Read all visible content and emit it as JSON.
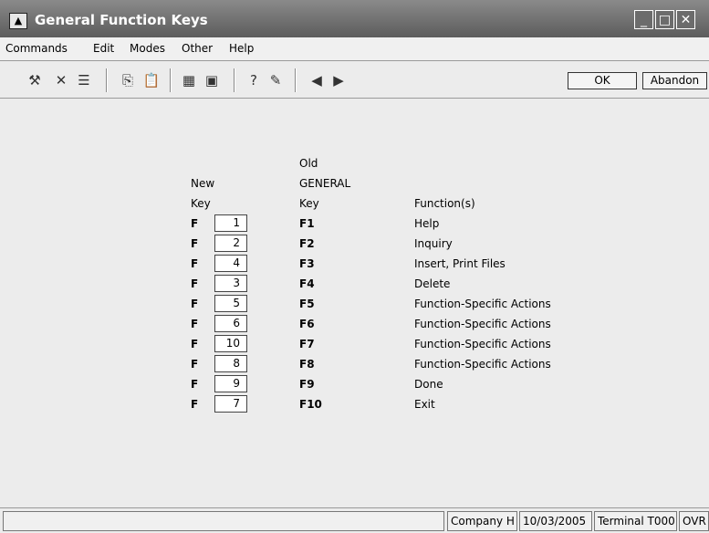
{
  "window": {
    "title": "General Function Keys",
    "icon": "app-icon",
    "controls": [
      "minimize",
      "maximize",
      "close"
    ]
  },
  "menu": [
    "Commands",
    "Edit",
    "Modes",
    "Other",
    "Help"
  ],
  "toolbar": {
    "icons": [
      "hammer-icon",
      "delete-x-icon",
      "list-icon",
      "copy-icon",
      "paste-icon",
      "calculator-icon",
      "calendar-icon",
      "help-question-icon",
      "notebook-icon",
      "previous-icon",
      "next-icon"
    ],
    "ok_label": "OK",
    "abandon_label": "Abandon"
  },
  "header": {
    "new_col": [
      "New",
      "Key"
    ],
    "old_col": [
      "Old",
      "GENERAL",
      "Key"
    ],
    "function_col": "Function(s)"
  },
  "rows": [
    {
      "prefix": "F",
      "new": "1",
      "old": "F1",
      "function": "Help"
    },
    {
      "prefix": "F",
      "new": "2",
      "old": "F2",
      "function": "Inquiry"
    },
    {
      "prefix": "F",
      "new": "4",
      "old": "F3",
      "function": "Insert, Print Files"
    },
    {
      "prefix": "F",
      "new": "3",
      "old": "F4",
      "function": "Delete"
    },
    {
      "prefix": "F",
      "new": "5",
      "old": "F5",
      "function": "Function-Specific Actions"
    },
    {
      "prefix": "F",
      "new": "6",
      "old": "F6",
      "function": "Function-Specific Actions"
    },
    {
      "prefix": "F",
      "new": "10",
      "old": "F7",
      "function": "Function-Specific Actions"
    },
    {
      "prefix": "F",
      "new": "8",
      "old": "F8",
      "function": "Function-Specific Actions"
    },
    {
      "prefix": "F",
      "new": "9",
      "old": "F9",
      "function": "Done"
    },
    {
      "prefix": "F",
      "new": "7",
      "old": "F10",
      "function": "Exit"
    }
  ],
  "status": {
    "company": "Company H",
    "date": "10/03/2005",
    "terminal": "Terminal T000",
    "mode": "OVR"
  }
}
